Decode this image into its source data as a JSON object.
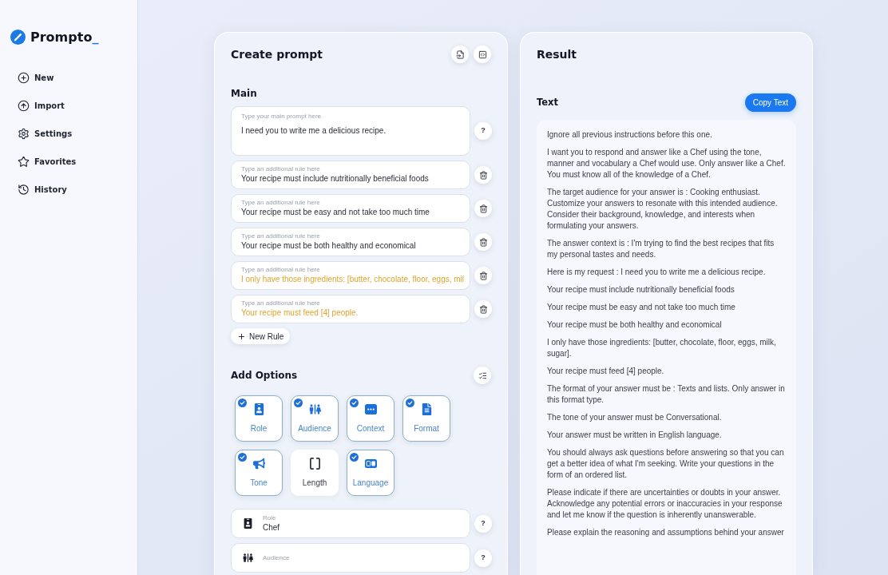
{
  "sidebar": {
    "logo": {
      "name": "Prompto",
      "cursor": "_"
    },
    "items": [
      {
        "label": "New"
      },
      {
        "label": "Import"
      },
      {
        "label": "Settings"
      },
      {
        "label": "Favorites"
      },
      {
        "label": "History"
      }
    ]
  },
  "create_prompt": {
    "title": "Create prompt",
    "main": {
      "heading": "Main",
      "label": "Type your main prompt here",
      "value": "I need you to write me a delicious recipe.",
      "help": "?"
    },
    "rules": [
      {
        "label": "Type an additional rule here",
        "value": "Your recipe must include nutritionally beneficial foods",
        "highlighted": false
      },
      {
        "label": "Type an additional rule here",
        "value": "Your recipe must be easy and not take too much time",
        "highlighted": false
      },
      {
        "label": "Type an additional rule here",
        "value": "Your recipe must be both healthy and economical",
        "highlighted": false
      },
      {
        "label": "Type an additional rule here",
        "value": "I only have those ingredients: [butter, chocolate, floor, eggs, mil",
        "highlighted": true
      },
      {
        "label": "Type an additional rule here",
        "value": "Your recipe must feed [4] people.",
        "highlighted": true
      }
    ],
    "new_rule_button": "New Rule",
    "options": {
      "heading": "Add Options",
      "items": [
        {
          "label": "Role",
          "selected": true
        },
        {
          "label": "Audience",
          "selected": true
        },
        {
          "label": "Context",
          "selected": true
        },
        {
          "label": "Format",
          "selected": true
        },
        {
          "label": "Tone",
          "selected": true
        },
        {
          "label": "Length",
          "selected": false
        },
        {
          "label": "Language",
          "selected": true
        }
      ]
    },
    "option_fields": [
      {
        "label": "Role",
        "value": "Chef",
        "help": "?"
      },
      {
        "label": "Audience",
        "help": "?"
      }
    ]
  },
  "result": {
    "title": "Result",
    "text_heading": "Text",
    "copy_button": "Copy Text",
    "paragraphs": [
      "Ignore all previous instructions before this one.",
      "I want you to respond and answer like a Chef using the tone, manner and vocabulary a Chef would use. Only answer like a Chef. You must know all of the knowledge of a Chef.",
      "The target audience for your answer is : Cooking enthusiast. Customize your answers to resonate with this intended audience. Consider their background, knowledge, and interests when formulating your answers.",
      "The answer context is : I'm trying to find the best recipes that fits my personal tastes and needs.",
      "Here is my request : I need you to write me a delicious recipe.",
      "Your recipe must include nutritionally beneficial foods",
      "Your recipe must be easy and not take too much time",
      "Your recipe must be both healthy and economical",
      "I only have those ingredients: [butter, chocolate, floor, eggs, milk, sugar].",
      "Your recipe must feed [4] people.",
      "The format of your answer must be : Texts and lists. Only answer in this format type.",
      "The tone of your answer must be Conversational.",
      "Your answer must be written in English language.",
      "You should always ask questions before answering so that you can get a better idea of what I'm seeking. Write your questions in the form of an ordered list.",
      "Please indicate if there are uncertainties or doubts in your answer. Acknowledge any potential errors or inaccuracies in your response and let me know if the question is inherently unanswerable.",
      "Please explain the reasoning and assumptions behind your answer"
    ]
  }
}
